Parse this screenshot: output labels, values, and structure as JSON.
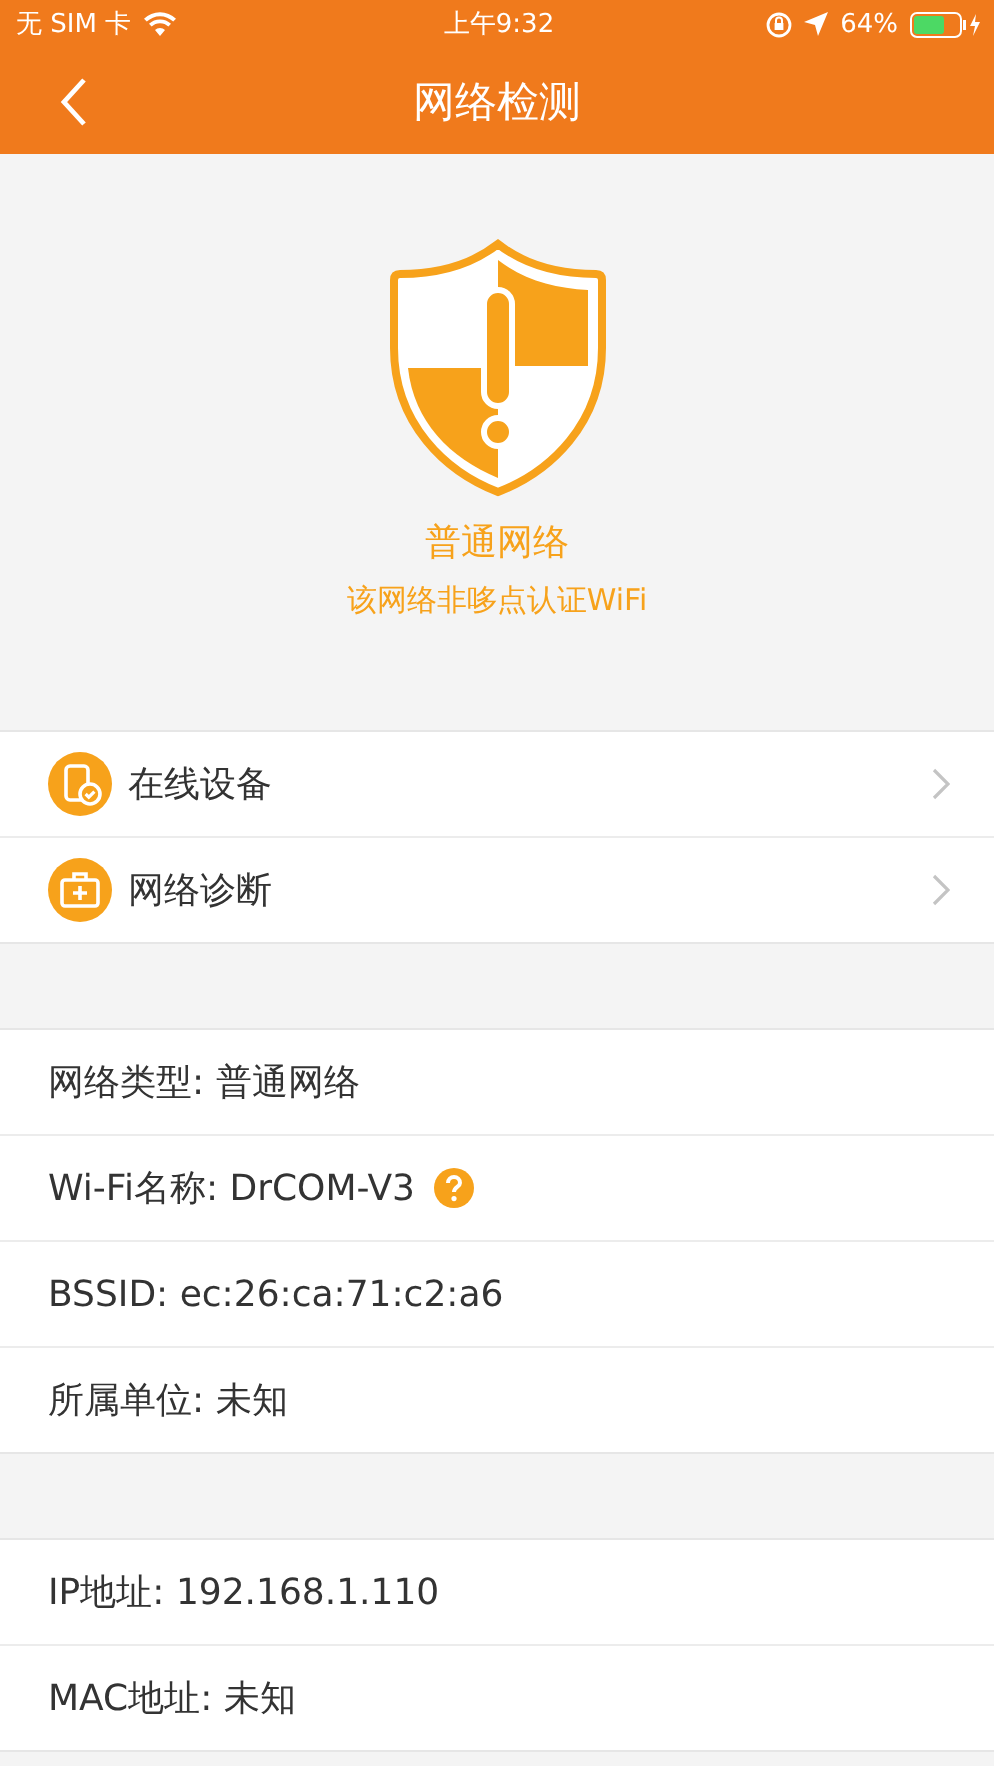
{
  "status_bar": {
    "carrier": "无 SIM 卡",
    "time": "上午9:32",
    "battery": "64%"
  },
  "nav": {
    "title": "网络检测"
  },
  "network": {
    "name": "普通网络",
    "description": "该网络非哆点认证WiFi"
  },
  "menu": [
    {
      "kind": "devices",
      "label": "在线设备"
    },
    {
      "kind": "diagnosis",
      "label": "网络诊断"
    }
  ],
  "info_groups": [
    [
      {
        "text": "网络类型: 普通网络",
        "help": false
      },
      {
        "text": "Wi-Fi名称: DrCOM-V3",
        "help": true
      },
      {
        "text": "BSSID: ec:26:ca:71:c2:a6",
        "help": false
      },
      {
        "text": "所属单位: 未知",
        "help": false
      }
    ],
    [
      {
        "text": "IP地址: 192.168.1.110",
        "help": false
      },
      {
        "text": "MAC地址: 未知",
        "help": false
      }
    ]
  ]
}
